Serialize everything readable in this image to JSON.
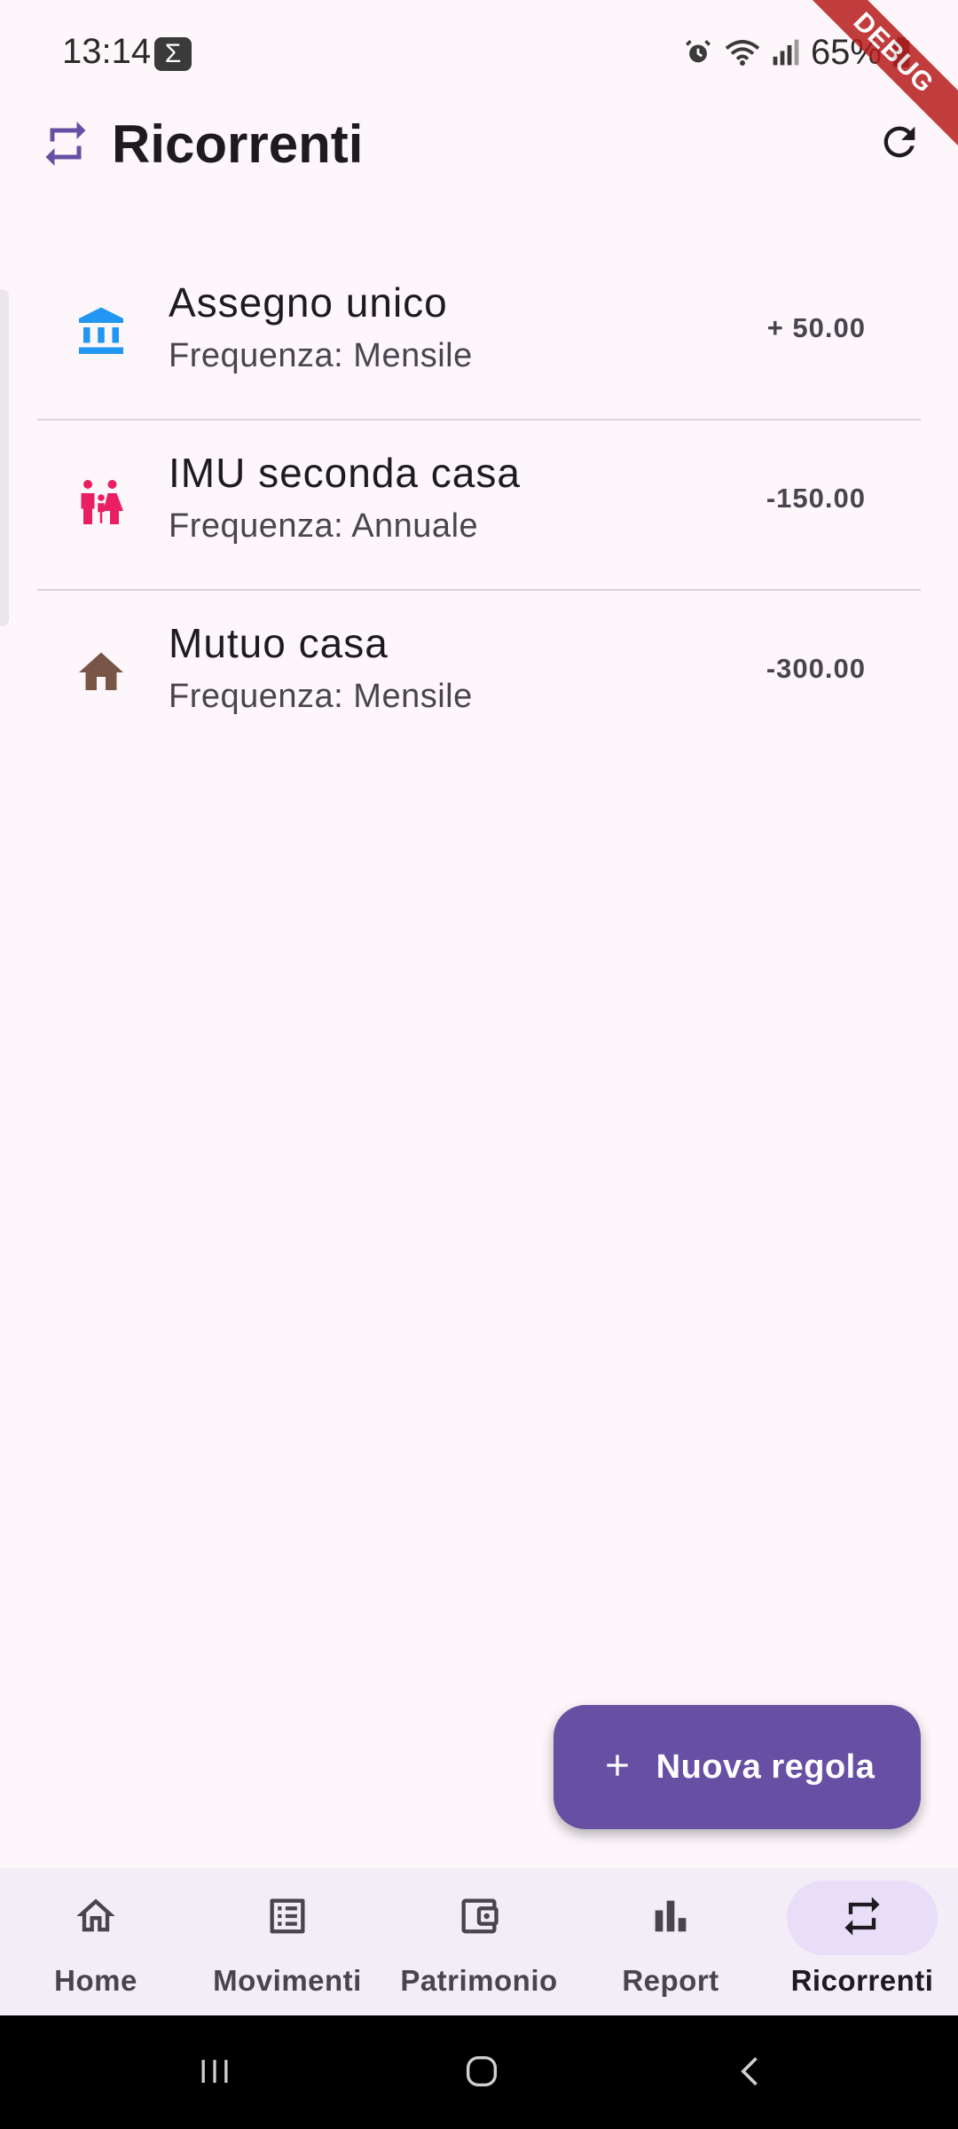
{
  "status_bar": {
    "time": "13:14",
    "app_icon_glyph": "Σ",
    "battery": "65%",
    "icons": [
      "alarm-icon",
      "wifi-icon",
      "signal-icon",
      "battery-icon"
    ]
  },
  "debug_banner": "DEBUG",
  "app_bar": {
    "title": "Ricorrenti",
    "icon": "repeat-icon",
    "action_icon": "refresh-icon"
  },
  "rules": [
    {
      "title": "Assegno unico",
      "frequency": "Frequenza: Mensile",
      "amount": "+ 50.00",
      "icon": "bank-icon",
      "icon_color": "#2196f3"
    },
    {
      "title": "IMU seconda casa",
      "frequency": "Frequenza: Annuale",
      "amount": "-150.00",
      "icon": "family-icon",
      "icon_color": "#e91e63"
    },
    {
      "title": "Mutuo casa",
      "frequency": "Frequenza: Mensile",
      "amount": "-300.00",
      "icon": "house-icon",
      "icon_color": "#795548"
    }
  ],
  "fab": {
    "label": "Nuova regola",
    "icon": "plus-icon"
  },
  "bottom_nav": [
    {
      "label": "Home",
      "icon": "home-icon",
      "active": false
    },
    {
      "label": "Movimenti",
      "icon": "list-icon",
      "active": false
    },
    {
      "label": "Patrimonio",
      "icon": "wallet-icon",
      "active": false
    },
    {
      "label": "Report",
      "icon": "bar-chart-icon",
      "active": false
    },
    {
      "label": "Ricorrenti",
      "icon": "repeat-icon",
      "active": true
    }
  ],
  "colors": {
    "background": "#fdf7fb",
    "primary": "#6750a4",
    "nav_background": "#f3edf7",
    "nav_active_pill": "#e8def8",
    "debug_ribbon": "#b71c1c"
  }
}
